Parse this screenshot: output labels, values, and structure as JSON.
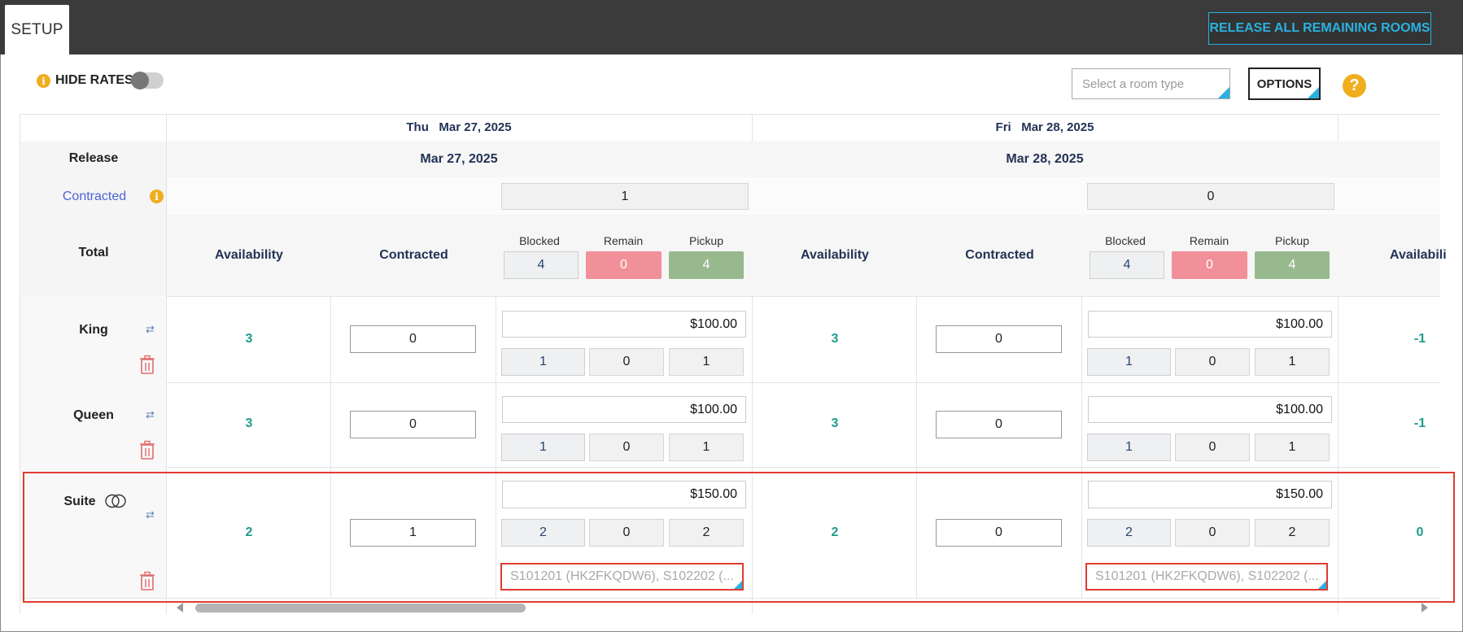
{
  "header": {
    "tab": "SETUP",
    "release_button": "RELEASE ALL REMAINING ROOMS"
  },
  "toolbar": {
    "hide_rates_label": "HIDE RATES",
    "room_type_placeholder": "Select a room type",
    "options_label": "OPTIONS",
    "help_glyph": "?",
    "info_glyph": "i"
  },
  "grid": {
    "row_labels": {
      "release": "Release",
      "contracted": "Contracted",
      "total": "Total"
    },
    "days": [
      {
        "day": "Thu",
        "date": "Mar 27, 2025",
        "release_date": "Mar 27, 2025",
        "contracted_total": "1",
        "headers": {
          "availability": "Availability",
          "contracted": "Contracted",
          "blocked": "Blocked",
          "remain": "Remain",
          "pickup": "Pickup"
        },
        "totals": {
          "blocked": "4",
          "remain": "0",
          "pickup": "4"
        },
        "rooms": [
          {
            "availability": "3",
            "contracted": "0",
            "rate": "$100.00",
            "blocked": "1",
            "remain": "0",
            "pickup": "1"
          },
          {
            "availability": "3",
            "contracted": "0",
            "rate": "$100.00",
            "blocked": "1",
            "remain": "0",
            "pickup": "1"
          },
          {
            "availability": "2",
            "contracted": "1",
            "rate": "$150.00",
            "blocked": "2",
            "remain": "0",
            "pickup": "2",
            "guests": "S101201 (HK2FKQDW6), S102202 (..."
          }
        ]
      },
      {
        "day": "Fri",
        "date": "Mar 28, 2025",
        "release_date": "Mar 28, 2025",
        "contracted_total": "0",
        "headers": {
          "availability": "Availability",
          "contracted": "Contracted",
          "blocked": "Blocked",
          "remain": "Remain",
          "pickup": "Pickup"
        },
        "totals": {
          "blocked": "4",
          "remain": "0",
          "pickup": "4"
        },
        "rooms": [
          {
            "availability": "3",
            "contracted": "0",
            "rate": "$100.00",
            "blocked": "1",
            "remain": "0",
            "pickup": "1"
          },
          {
            "availability": "3",
            "contracted": "0",
            "rate": "$100.00",
            "blocked": "1",
            "remain": "0",
            "pickup": "1"
          },
          {
            "availability": "2",
            "contracted": "0",
            "rate": "$150.00",
            "blocked": "2",
            "remain": "0",
            "pickup": "2",
            "guests": "S101201 (HK2FKQDW6), S102202 (..."
          }
        ]
      },
      {
        "headers": {
          "availability": "Availabili"
        },
        "rooms": [
          {
            "availability": "-1"
          },
          {
            "availability": "-1"
          },
          {
            "availability": "0"
          }
        ]
      }
    ],
    "rooms": [
      {
        "name": "King"
      },
      {
        "name": "Queen"
      },
      {
        "name": "Suite"
      }
    ]
  },
  "colors": {
    "accent": "#2ab1e0",
    "remain": "#f2909a",
    "pickup": "#98b98d",
    "availability": "#1f9c8c",
    "highlight": "#e03c31",
    "info": "#f0ad1e"
  }
}
